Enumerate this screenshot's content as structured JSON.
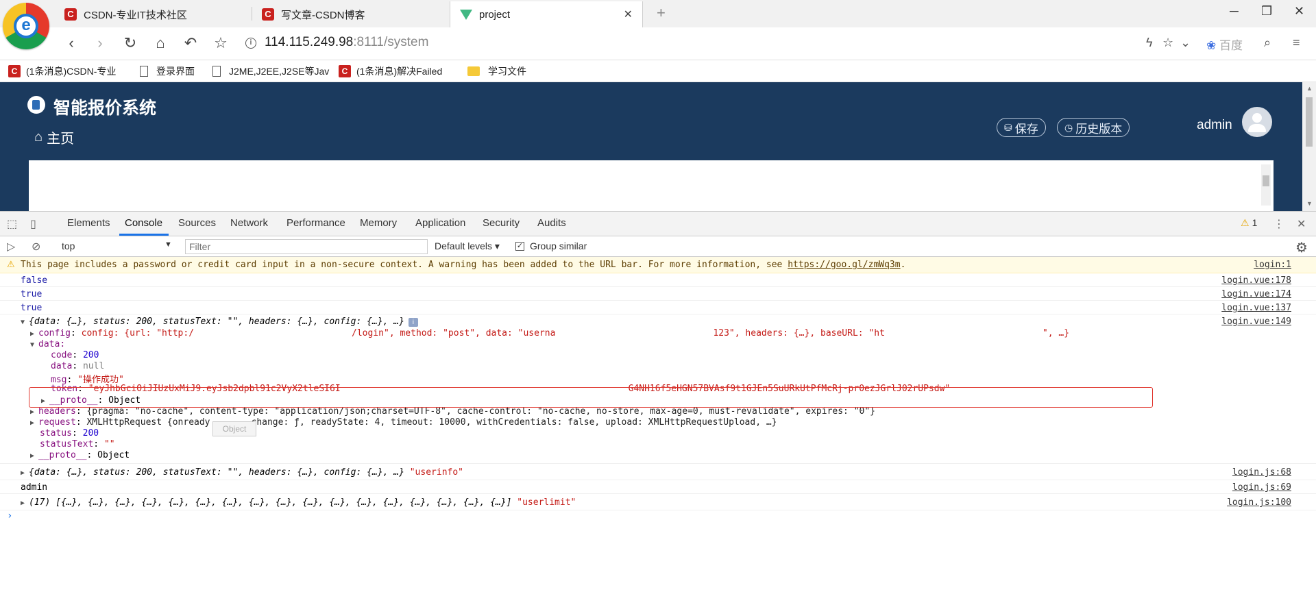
{
  "browser": {
    "tabs": [
      {
        "label": "CSDN-专业IT技术社区",
        "fav": "C"
      },
      {
        "label": "写文章-CSDN博客",
        "fav": "C"
      },
      {
        "label": "project",
        "fav": "vue"
      }
    ],
    "url_host": "114.115.249.98",
    "url_rest": ":8111/system",
    "search_engine": "百度",
    "bookmarks": [
      {
        "label": "(1条消息)CSDN-专业",
        "icon": "csdn"
      },
      {
        "label": "登录界面",
        "icon": "doc"
      },
      {
        "label": "J2ME,J2EE,J2SE等Jav",
        "icon": "doc"
      },
      {
        "label": "(1条消息)解决Failed",
        "icon": "csdn"
      },
      {
        "label": "学习文件",
        "icon": "folder"
      }
    ]
  },
  "app": {
    "title": "智能报价系统",
    "home_label": "主页",
    "save_label": "保存",
    "history_label": "历史版本",
    "user": "admin",
    "header_color": "#1b3a5e"
  },
  "devtools": {
    "tabs": [
      "Elements",
      "Console",
      "Sources",
      "Network",
      "Performance",
      "Memory",
      "Application",
      "Security",
      "Audits"
    ],
    "active_tab": "Console",
    "warning_count": "1",
    "context": "top",
    "filter_placeholder": "Filter",
    "levels": "Default levels",
    "group_similar": "Group similar"
  },
  "console": {
    "warning": {
      "text": "This page includes a password or credit card input in a non-secure context. A warning has been added to the URL bar. For more information, see ",
      "link": "https://goo.gl/zmWq3m",
      "tail": ".",
      "source": "login:1"
    },
    "logs": [
      {
        "text": "false",
        "source": "login.vue:178"
      },
      {
        "text": "true",
        "source": "login.vue:174"
      },
      {
        "text": "true",
        "source": "login.vue:137"
      }
    ],
    "response": {
      "summary": "{data: {…}, status: 200, statusText: \"\", headers: {…}, config: {…}, …}",
      "source": "login.vue:149",
      "config_line": "config: {url: \"http:/",
      "config_mid": "/login\", method: \"post\", data: \"userna",
      "config_mid2": "123\", headers: {…}, baseURL: \"ht",
      "config_tail": "\", …}",
      "data_label": "data:",
      "code": "200",
      "data_null": "null",
      "msg": "\"操作成功\"",
      "token_head": "\"eyJhbGciOiJIUzUxMiJ9.eyJsb2dpbl91c2VyX2tleSI6I",
      "token_tail": "G4NH16f5eHGN57BVAsf9t1GJEn5SuURkUtPfMcRj-pr0ezJGrlJ02rUPsdw\"",
      "proto_label": "__proto__",
      "proto_value": "Object",
      "headers": "{pragma: \"no-cache\", content-type: \"application/json;charset=UTF-8\", cache-control: \"no-cache, no-store, max-age=0, must-revalidate\", expires: \"0\"}",
      "request_head": "XMLHttpRequest {onready",
      "request_tail": "change: ƒ, readyState: 4, timeout: 10000, withCredentials: false, upload: XMLHttpRequestUpload, …}",
      "status": "200",
      "statusText": "\"\"",
      "tooltip": "Object"
    },
    "userinfo": {
      "summary": "{data: {…}, status: 200, statusText: \"\", headers: {…}, config: {…}, …}",
      "label": "\"userinfo\"",
      "source": "login.js:68"
    },
    "admin_log": {
      "text": "admin",
      "source": "login.js:69"
    },
    "userlimit": {
      "summary": "(17) [{…}, {…}, {…}, {…}, {…}, {…}, {…}, {…}, {…}, {…}, {…}, {…}, {…}, {…}, {…}, {…}, {…}]",
      "label": "\"userlimit\"",
      "source": "login.js:100"
    }
  }
}
